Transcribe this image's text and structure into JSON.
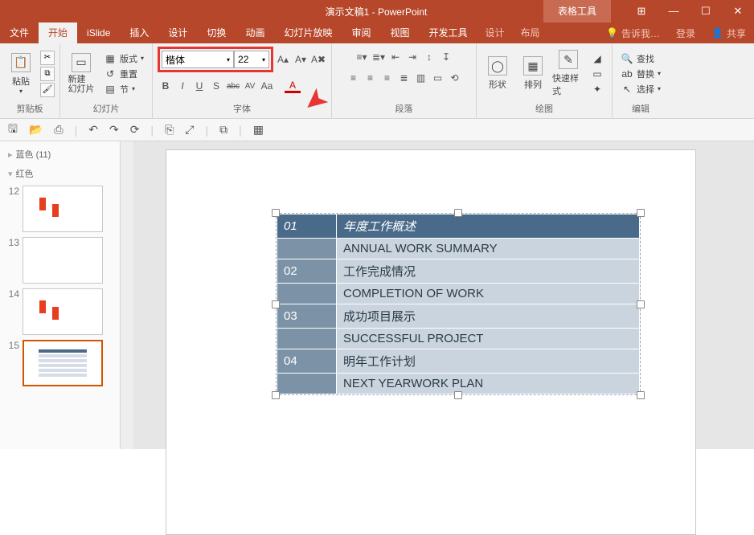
{
  "titlebar": {
    "title": "演示文稿1 - PowerPoint",
    "tools_tab": "表格工具",
    "win": [
      "⊞",
      "—",
      "☐",
      "✕"
    ]
  },
  "tabs": {
    "items": [
      "文件",
      "开始",
      "iSlide",
      "插入",
      "设计",
      "切换",
      "动画",
      "幻灯片放映",
      "审阅",
      "视图",
      "开发工具"
    ],
    "ctx": [
      "设计",
      "布局"
    ],
    "tell": "告诉我…",
    "login": "登录",
    "share": "共享"
  },
  "ribbon": {
    "clipboard": {
      "paste": "粘贴",
      "label": "剪贴板"
    },
    "slides": {
      "new": "新建\n幻灯片",
      "layout": "版式",
      "reset": "重置",
      "section": "节",
      "label": "幻灯片"
    },
    "font": {
      "name": "楷体",
      "size": "22",
      "btns": [
        "B",
        "I",
        "U",
        "S",
        "abc",
        "AV",
        "Aa",
        "A"
      ],
      "label": "字体"
    },
    "para": {
      "label": "段落"
    },
    "draw": {
      "shape": "形状",
      "arrange": "排列",
      "quick": "快速样式",
      "label": "绘图"
    },
    "edit": {
      "find": "查找",
      "replace": "替换",
      "select": "选择",
      "label": "编辑"
    }
  },
  "qat": [
    "🖫",
    "📂",
    "⎙",
    "",
    "↶",
    "↷",
    "⟳",
    "",
    "⎘",
    "⤢",
    "",
    "⧉",
    "",
    "▦"
  ],
  "thumbs": {
    "sec1": "蓝色 (11)",
    "sec2": "红色",
    "nums": [
      "12",
      "13",
      "14",
      "15"
    ]
  },
  "table": {
    "rows": [
      [
        "01",
        "年度工作概述"
      ],
      [
        "",
        "ANNUAL WORK SUMMARY"
      ],
      [
        "02",
        "工作完成情况"
      ],
      [
        "",
        "COMPLETION OF WORK"
      ],
      [
        "03",
        "成功项目展示"
      ],
      [
        "",
        "SUCCESSFUL PROJECT"
      ],
      [
        "04",
        "明年工作计划"
      ],
      [
        "",
        "NEXT YEARWORK PLAN"
      ]
    ]
  }
}
